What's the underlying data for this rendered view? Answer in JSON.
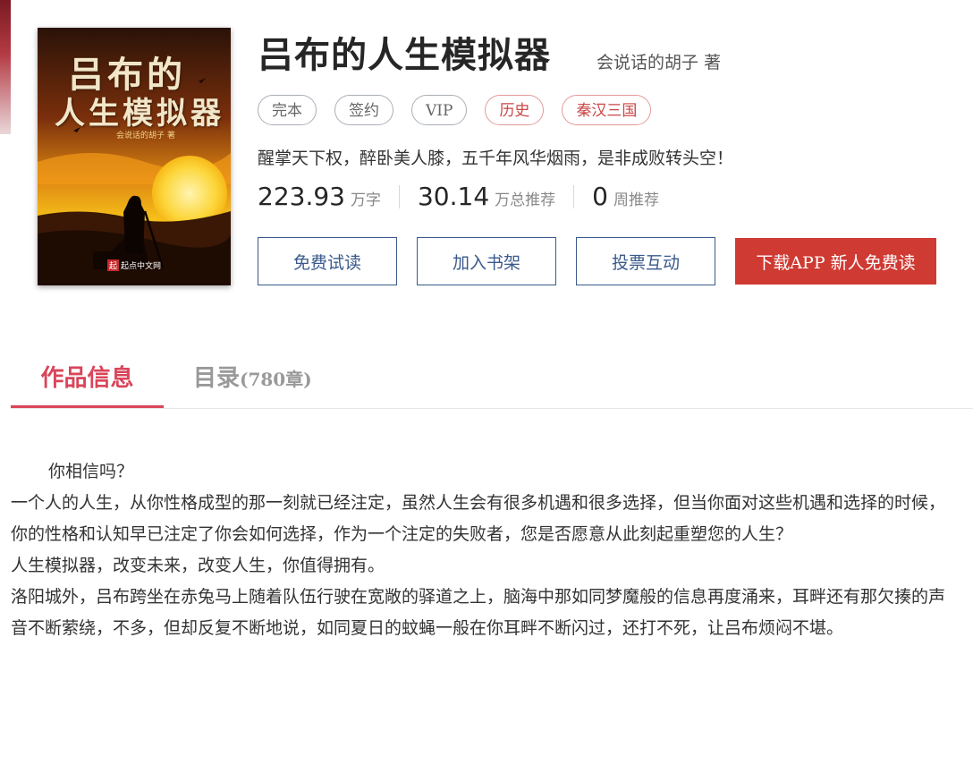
{
  "book": {
    "cover": {
      "title_line1": "吕布的",
      "title_line2": "人生模拟器",
      "author_small": "会说话的胡子 著",
      "logo_text": "起点中文网",
      "logo_badge": "起"
    },
    "title": "吕布的人生模拟器",
    "author": "会说话的胡子",
    "author_suffix": "著",
    "tags": [
      {
        "label": "完本",
        "kind": "status"
      },
      {
        "label": "签约",
        "kind": "status"
      },
      {
        "label": "VIP",
        "kind": "status"
      },
      {
        "label": "历史",
        "kind": "category"
      },
      {
        "label": "秦汉三国",
        "kind": "category"
      }
    ],
    "intro": "醒掌天下权，醉卧美人膝，五千年风华烟雨，是非成败转头空！",
    "stats": [
      {
        "value": "223.93",
        "unit": "万字"
      },
      {
        "value": "30.14",
        "unit": "万总推荐"
      },
      {
        "value": "0",
        "unit": "周推荐"
      }
    ]
  },
  "actions": {
    "free_read": "免费试读",
    "add_shelf": "加入书架",
    "vote": "投票互动",
    "download_app": "下载APP 新人免费读"
  },
  "tabs": {
    "info": "作品信息",
    "catalog": "目录",
    "catalog_count": "(780章)"
  },
  "description": [
    "你相信吗？",
    "一个人的人生，从你性格成型的那一刻就已经注定，虽然人生会有很多机遇和很多选择，但当你面对这些机遇和选择的时候，你的性格和认知早已注定了你会如何选择，作为一个注定的失败者，您是否愿意从此刻起重塑您的人生？",
    "人生模拟器，改变未来，改变人生，你值得拥有。",
    "洛阳城外，吕布跨坐在赤兔马上随着队伍行驶在宽敞的驿道之上，脑海中那如同梦魔般的信息再度涌来，耳畔还有那欠揍的声音不断萦绕，不多，但却反复不断地说，如同夏日的蚊蝇一般在你耳畔不断闪过，还打不死，让吕布烦闷不堪。"
  ],
  "colors": {
    "accent_red": "#cf3a33",
    "tab_active": "#d9455a",
    "button_border": "#3a5a8c"
  }
}
